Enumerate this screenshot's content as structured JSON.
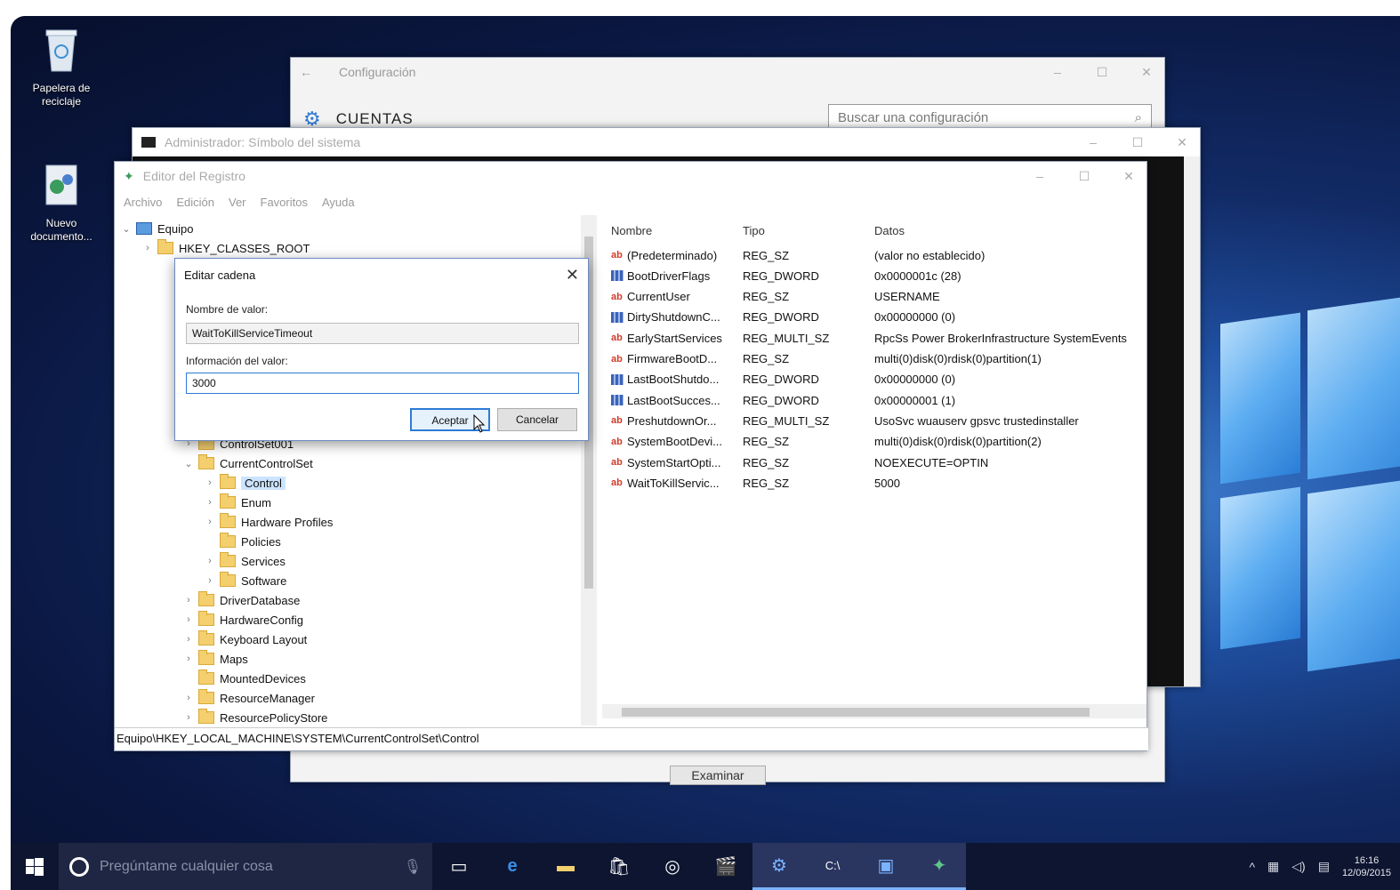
{
  "desktop": {
    "icons": [
      {
        "label": "Papelera de reciclaje"
      },
      {
        "label": "Nuevo documento..."
      }
    ]
  },
  "config_window": {
    "title": "Configuración",
    "heading": "CUENTAS",
    "search_placeholder": "Buscar una configuración",
    "examinar_label": "Examinar"
  },
  "cmd_window": {
    "title": "Administrador: Símbolo del sistema"
  },
  "regedit": {
    "title": "Editor del Registro",
    "menu": [
      "Archivo",
      "Edición",
      "Ver",
      "Favoritos",
      "Ayuda"
    ],
    "tree": [
      {
        "label": "Equipo",
        "level": 0
      },
      {
        "label": "HKEY_CLASSES_ROOT",
        "level": 1
      },
      {
        "label": "ControlSet001",
        "level": 3
      },
      {
        "label": "CurrentControlSet",
        "level": 3
      },
      {
        "label": "Control",
        "level": 4,
        "selected": true
      },
      {
        "label": "Enum",
        "level": 4
      },
      {
        "label": "Hardware Profiles",
        "level": 4
      },
      {
        "label": "Policies",
        "level": 4
      },
      {
        "label": "Services",
        "level": 4
      },
      {
        "label": "Software",
        "level": 4
      },
      {
        "label": "DriverDatabase",
        "level": 3
      },
      {
        "label": "HardwareConfig",
        "level": 3
      },
      {
        "label": "Keyboard Layout",
        "level": 3
      },
      {
        "label": "Maps",
        "level": 3
      },
      {
        "label": "MountedDevices",
        "level": 3
      },
      {
        "label": "ResourceManager",
        "level": 3
      },
      {
        "label": "ResourcePolicyStore",
        "level": 3
      }
    ],
    "columns": {
      "name": "Nombre",
      "type": "Tipo",
      "data": "Datos"
    },
    "values": [
      {
        "name": "(Predeterminado)",
        "type": "REG_SZ",
        "data": "(valor no establecido)",
        "kind": "sz"
      },
      {
        "name": "BootDriverFlags",
        "type": "REG_DWORD",
        "data": "0x0000001c (28)",
        "kind": "dw"
      },
      {
        "name": "CurrentUser",
        "type": "REG_SZ",
        "data": "USERNAME",
        "kind": "sz"
      },
      {
        "name": "DirtyShutdownC...",
        "type": "REG_DWORD",
        "data": "0x00000000 (0)",
        "kind": "dw"
      },
      {
        "name": "EarlyStartServices",
        "type": "REG_MULTI_SZ",
        "data": "RpcSs Power BrokerInfrastructure SystemEvents",
        "kind": "sz"
      },
      {
        "name": "FirmwareBootD...",
        "type": "REG_SZ",
        "data": "multi(0)disk(0)rdisk(0)partition(1)",
        "kind": "sz"
      },
      {
        "name": "LastBootShutdo...",
        "type": "REG_DWORD",
        "data": "0x00000000 (0)",
        "kind": "dw"
      },
      {
        "name": "LastBootSucces...",
        "type": "REG_DWORD",
        "data": "0x00000001 (1)",
        "kind": "dw"
      },
      {
        "name": "PreshutdownOr...",
        "type": "REG_MULTI_SZ",
        "data": "UsoSvc wuauserv gpsvc trustedinstaller",
        "kind": "sz"
      },
      {
        "name": "SystemBootDevi...",
        "type": "REG_SZ",
        "data": "multi(0)disk(0)rdisk(0)partition(2)",
        "kind": "sz"
      },
      {
        "name": "SystemStartOpti...",
        "type": "REG_SZ",
        "data": " NOEXECUTE=OPTIN",
        "kind": "sz"
      },
      {
        "name": "WaitToKillServic...",
        "type": "REG_SZ",
        "data": "5000",
        "kind": "sz"
      }
    ],
    "status_path": "Equipo\\HKEY_LOCAL_MACHINE\\SYSTEM\\CurrentControlSet\\Control"
  },
  "dialog": {
    "title": "Editar cadena",
    "name_label": "Nombre de valor:",
    "name_value": "WaitToKillServiceTimeout",
    "data_label": "Información del valor:",
    "data_value": "3000",
    "ok_label": "Aceptar",
    "cancel_label": "Cancelar"
  },
  "taskbar": {
    "search_placeholder": "Pregúntame cualquier cosa",
    "time": "16:16",
    "date": "12/09/2015"
  },
  "colors": {
    "accent": "#2e7bd6",
    "taskbar": "#0d1530",
    "desktop_dark": "#0a1740"
  }
}
